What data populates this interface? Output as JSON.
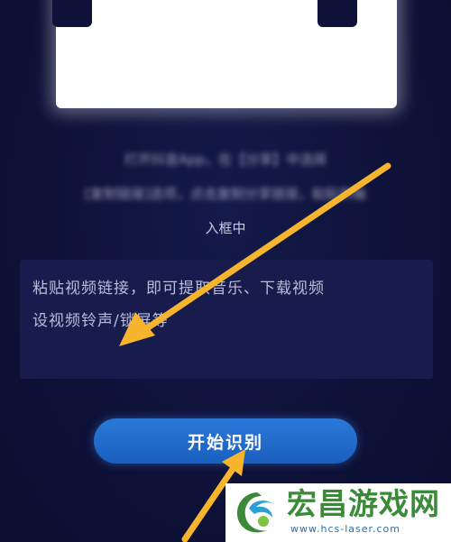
{
  "instructions": {
    "line1": "打开抖音App，在【分享】中选择",
    "line2": "[复制链接]选项，点击复制分享链接，粘贴到输",
    "line3": "入框中"
  },
  "link_input": {
    "placeholder_visible": "粘贴视频链接，即可提取音乐、下载视频",
    "placeholder_blur": "视频",
    "placeholder_line2": "设视频铃声/锁屏等"
  },
  "start_button": {
    "label": "开始识别"
  },
  "watermark": {
    "brand": "宏昌游戏网",
    "site": "www.hcs-laser.com"
  },
  "colors": {
    "background": "#0e1239",
    "button": "#1f6acb",
    "arrow": "#f6b52c",
    "brand_green": "#3b8a3a"
  }
}
